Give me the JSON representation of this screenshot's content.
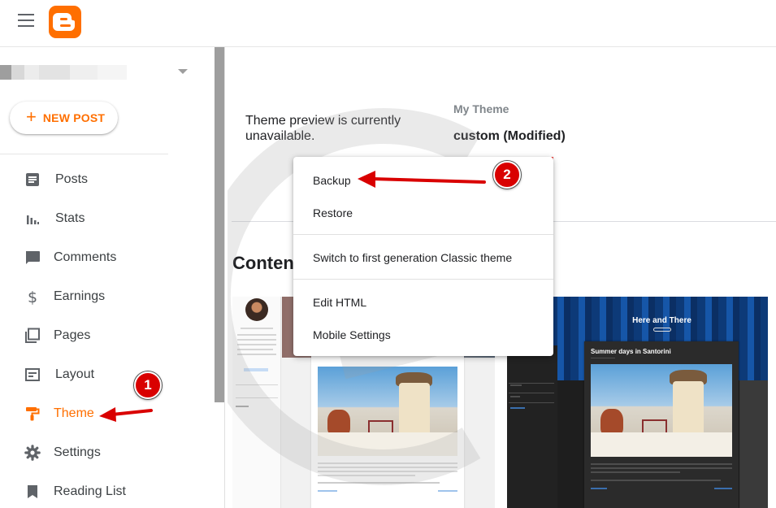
{
  "header": {
    "menu_icon": "hamburger-menu-icon",
    "logo_icon": "blogger-logo-icon"
  },
  "sidebar": {
    "blog_selector_icon": "caret-down-icon",
    "new_post_label": "NEW POST",
    "new_post_icon": "plus-icon",
    "items": [
      {
        "label": "Posts",
        "icon": "posts-icon"
      },
      {
        "label": "Stats",
        "icon": "stats-icon"
      },
      {
        "label": "Comments",
        "icon": "comments-icon"
      },
      {
        "label": "Earnings",
        "icon": "dollar-icon"
      },
      {
        "label": "Pages",
        "icon": "pages-icon"
      },
      {
        "label": "Layout",
        "icon": "layout-icon"
      },
      {
        "label": "Theme",
        "icon": "paint-roller-icon",
        "active": true
      },
      {
        "label": "Settings",
        "icon": "gear-icon"
      },
      {
        "label": "Reading List",
        "icon": "bookmark-icon"
      }
    ]
  },
  "main": {
    "preview_message": "Theme preview is currently unavailable.",
    "my_theme_label": "My Theme",
    "theme_name": "custom (Modified)",
    "content_heading": "Conten",
    "dark_thumb_title": "Here and There",
    "dark_thumb_post_title": "Summer days in Santorini"
  },
  "menu": {
    "items": [
      "Backup",
      "Restore",
      "Switch to first generation Classic theme",
      "Edit HTML",
      "Mobile Settings"
    ]
  },
  "annotations": {
    "step1": "1",
    "step2": "2"
  },
  "colors": {
    "accent": "#ff6f00",
    "annotation_red": "#d90000"
  }
}
